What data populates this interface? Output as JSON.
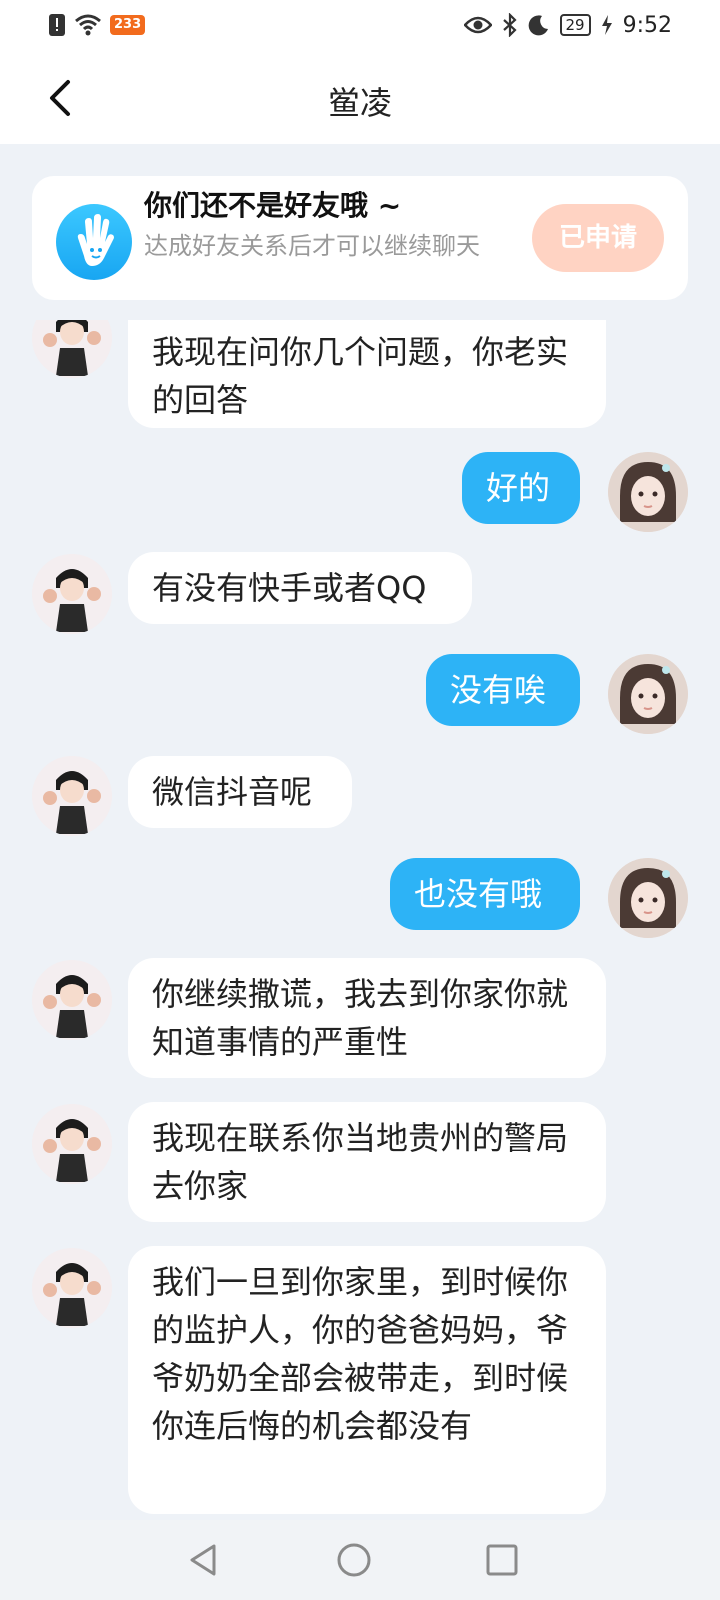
{
  "status_bar": {
    "app_badge": "233",
    "battery": "29",
    "time": "9:52"
  },
  "header": {
    "title": "鲎凌"
  },
  "friend_banner": {
    "title": "你们还不是好友哦 ~",
    "subtitle": "达成好友关系后才可以继续聊天",
    "button_label": "已申请"
  },
  "messages": [
    {
      "from": "other",
      "text": "我现在问你几个问题，你老实的回答"
    },
    {
      "from": "me",
      "text": "好的"
    },
    {
      "from": "other",
      "text": "有没有快手或者QQ"
    },
    {
      "from": "me",
      "text": "没有唉"
    },
    {
      "from": "other",
      "text": "微信抖音呢"
    },
    {
      "from": "me",
      "text": "也没有哦"
    },
    {
      "from": "other",
      "text": "你继续撒谎，我去到你家你就知道事情的严重性"
    },
    {
      "from": "other",
      "text": "我现在联系你当地贵州的警局去你家"
    },
    {
      "from": "other",
      "text": "我们一旦到你家里，到时候你的监护人，你的爸爸妈妈，爷爷奶奶全部会被带走，到时候你连后悔的机会都没有"
    }
  ]
}
